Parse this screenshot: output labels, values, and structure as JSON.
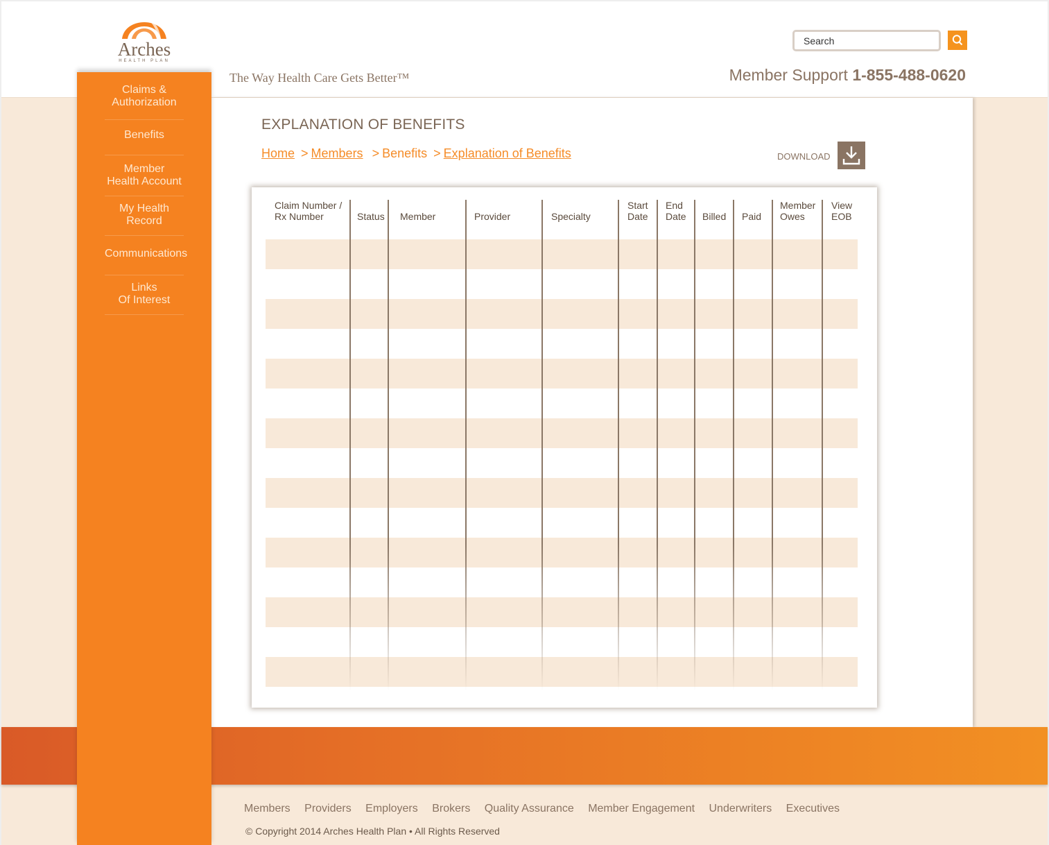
{
  "brand": {
    "logo_word": "Arches",
    "logo_sub": "HEALTH PLAN",
    "tagline": "The Way Health Care Gets Better™"
  },
  "header": {
    "search_placeholder": "Search",
    "support_label": "Member Support",
    "support_phone": "1-855-488-0620"
  },
  "sidebar": {
    "items": [
      {
        "line1": "Claims &",
        "line2": "Authorization"
      },
      {
        "line1": "Benefits",
        "line2": ""
      },
      {
        "line1": "Member",
        "line2": "Health Account"
      },
      {
        "line1": "My Health",
        "line2": "Record"
      },
      {
        "line1": "Communications",
        "line2": ""
      },
      {
        "line1": "Links",
        "line2": "Of Interest"
      }
    ]
  },
  "main": {
    "title": "EXPLANATION OF BENEFITS",
    "breadcrumb": {
      "home": "Home",
      "sep1": ">",
      "members": "Members",
      "sep2": ">",
      "benefits": "Benefits",
      "sep3": ">",
      "current": "Explanation of Benefits"
    },
    "download_label": "DOWNLOAD"
  },
  "table": {
    "headers": [
      {
        "line1": "Claim Number /",
        "line2": "Rx Number"
      },
      {
        "line1": "",
        "line2": "Status"
      },
      {
        "line1": "",
        "line2": "Member"
      },
      {
        "line1": "",
        "line2": "Provider"
      },
      {
        "line1": "",
        "line2": "Specialty"
      },
      {
        "line1": "Start",
        "line2": "Date"
      },
      {
        "line1": "End",
        "line2": "Date"
      },
      {
        "line1": "",
        "line2": "Billed"
      },
      {
        "line1": "",
        "line2": "Paid"
      },
      {
        "line1": "Member",
        "line2": "Owes"
      },
      {
        "line1": "View",
        "line2": "EOB"
      }
    ]
  },
  "footer": {
    "links": [
      "Members",
      "Providers",
      "Employers",
      "Brokers",
      "Quality Assurance",
      "Member Engagement",
      "Underwriters",
      "Executives"
    ],
    "copyright": "© Copyright 2014 Arches Health Plan • All Rights Reserved"
  },
  "colors": {
    "accent_orange": "#f58220",
    "brown_text": "#7a6554",
    "row_tint": "#f8e9d9"
  }
}
